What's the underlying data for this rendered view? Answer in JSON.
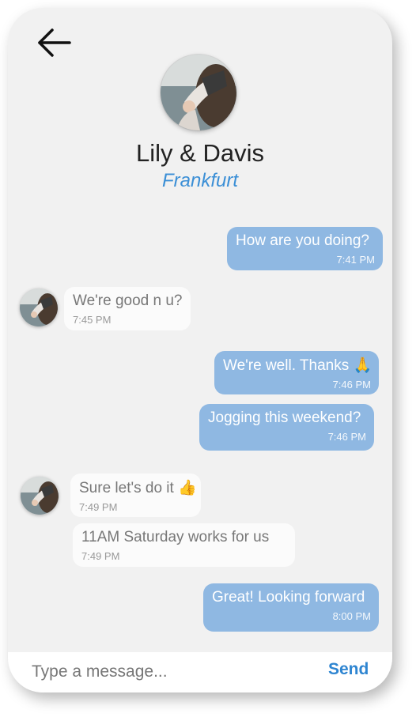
{
  "header": {
    "back_icon": "arrow-left-icon",
    "contact_name": "Lily & Davis",
    "contact_location": "Frankfurt",
    "avatar_icon": "contact-photo"
  },
  "colors": {
    "outgoing_bubble": "#8fb8e2",
    "incoming_bubble": "#fbfbfb",
    "accent": "#3b8fd6",
    "background": "#f1f1f1"
  },
  "messages": [
    {
      "direction": "out",
      "text": "How are you doing?",
      "time": "7:41 PM"
    },
    {
      "direction": "in",
      "text": "We're good n u?",
      "time": "7:45 PM"
    },
    {
      "direction": "out",
      "text": "We're well. Thanks 🙏",
      "time": "7:46 PM"
    },
    {
      "direction": "out",
      "text": "Jogging this weekend?",
      "time": "7:46 PM"
    },
    {
      "direction": "in",
      "text": "Sure let's do it 👍",
      "time": "7:49 PM"
    },
    {
      "direction": "in",
      "text": "11AM Saturday works for us",
      "time": "7:49 PM"
    },
    {
      "direction": "out",
      "text": "Great! Looking forward",
      "time": "8:00 PM"
    }
  ],
  "composer": {
    "placeholder": "Type a message...",
    "value": "",
    "send_label": "Send"
  }
}
